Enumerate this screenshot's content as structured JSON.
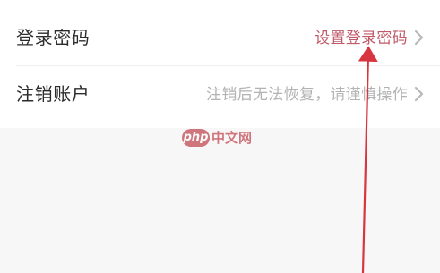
{
  "settings": {
    "rows": [
      {
        "label": "登录密码",
        "value": "设置登录密码",
        "value_color": "#c05a68",
        "icon": "chevron-right-icon"
      },
      {
        "label": "注销账户",
        "value": "注销后无法恢复，请谨慎操作",
        "value_color": "#b3b3b3",
        "icon": "chevron-right-icon"
      }
    ]
  },
  "watermark": {
    "badge": "php",
    "text": "中文网"
  },
  "colors": {
    "accent": "#c05a68",
    "muted": "#b3b3b3",
    "arrow": "#d7353f",
    "background": "#f7f7f7"
  }
}
